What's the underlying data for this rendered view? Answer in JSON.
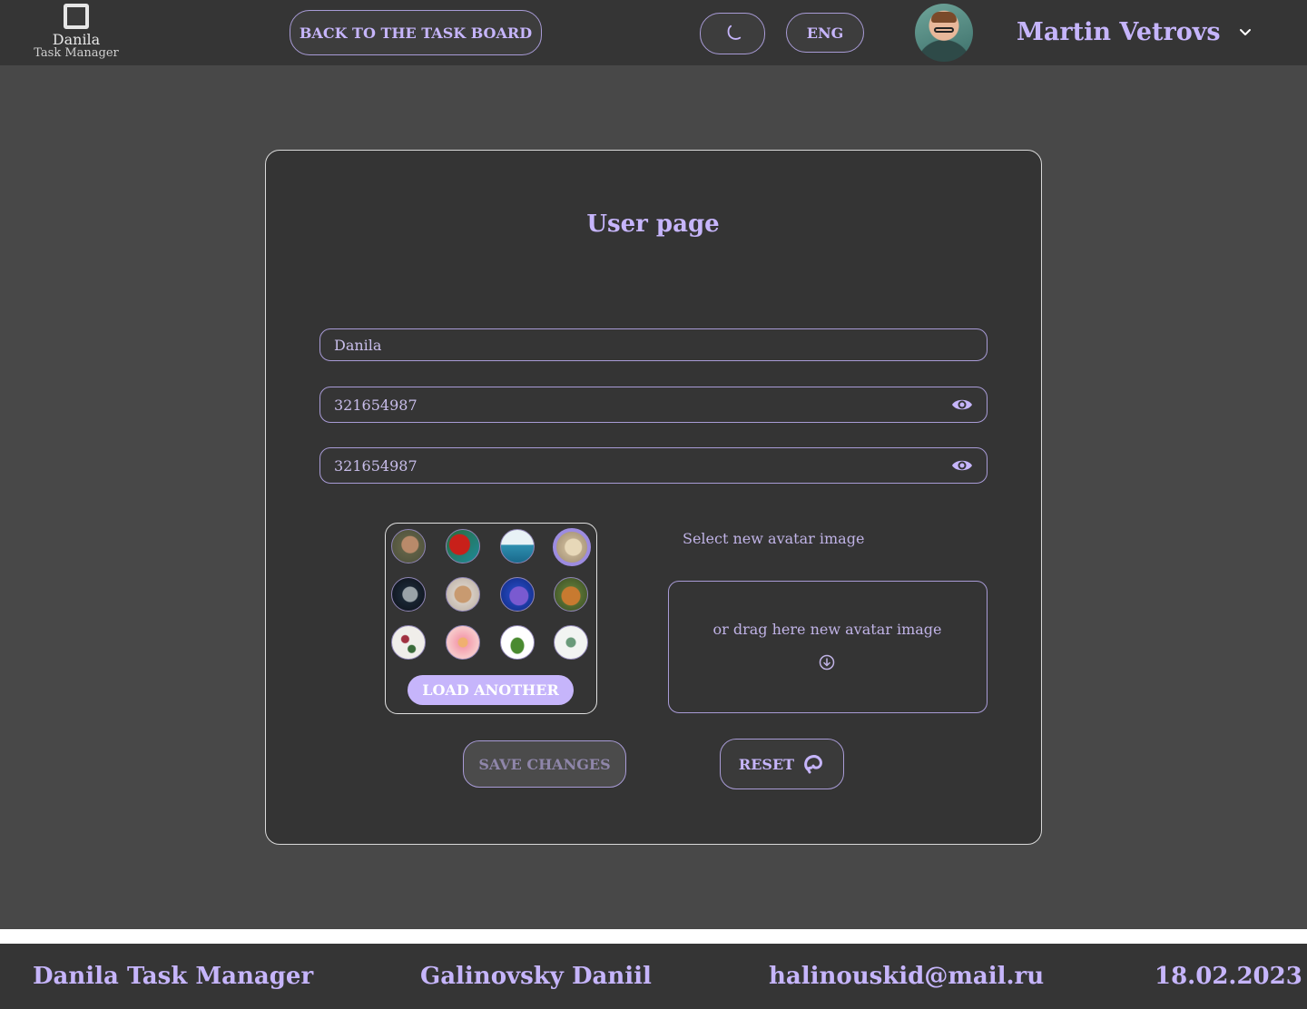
{
  "header": {
    "logo_title": "Danila",
    "logo_subtitle": "Task Manager",
    "back_label": "BACK TO THE TASK BOARD",
    "language": "ENG",
    "user_name": "Martin Vetrovs",
    "icons": [
      "logo-icon",
      "moon-icon",
      "chevron-down-icon"
    ]
  },
  "card": {
    "title": "User page",
    "name_value": "Danila",
    "password_value": "321654987",
    "password_confirm_value": "321654987",
    "select_label": "Select new avatar image",
    "drop_text": "or drag here new avatar image",
    "load_another_label": "LOAD ANOTHER",
    "save_label": "SAVE CHANGES",
    "reset_label": "RESET",
    "avatars": [
      {
        "name": "rabbit",
        "selected": false
      },
      {
        "name": "parrot",
        "selected": false
      },
      {
        "name": "whale",
        "selected": false
      },
      {
        "name": "lion",
        "selected": true
      },
      {
        "name": "wolf",
        "selected": false
      },
      {
        "name": "cat",
        "selected": false
      },
      {
        "name": "fish",
        "selected": false
      },
      {
        "name": "tiger",
        "selected": false
      },
      {
        "name": "flower-branch",
        "selected": false
      },
      {
        "name": "peony",
        "selected": false
      },
      {
        "name": "leaves",
        "selected": false
      },
      {
        "name": "twig",
        "selected": false
      }
    ]
  },
  "footer": {
    "app_name": "Danila Task Manager",
    "author": "Galinovsky Daniil",
    "email": "halinouskid@mail.ru",
    "date": "18.02.2023"
  },
  "colors": {
    "accent": "#c6b5fb",
    "header_bg": "#353535",
    "page_bg": "#484848",
    "card_bg": "#343434"
  }
}
